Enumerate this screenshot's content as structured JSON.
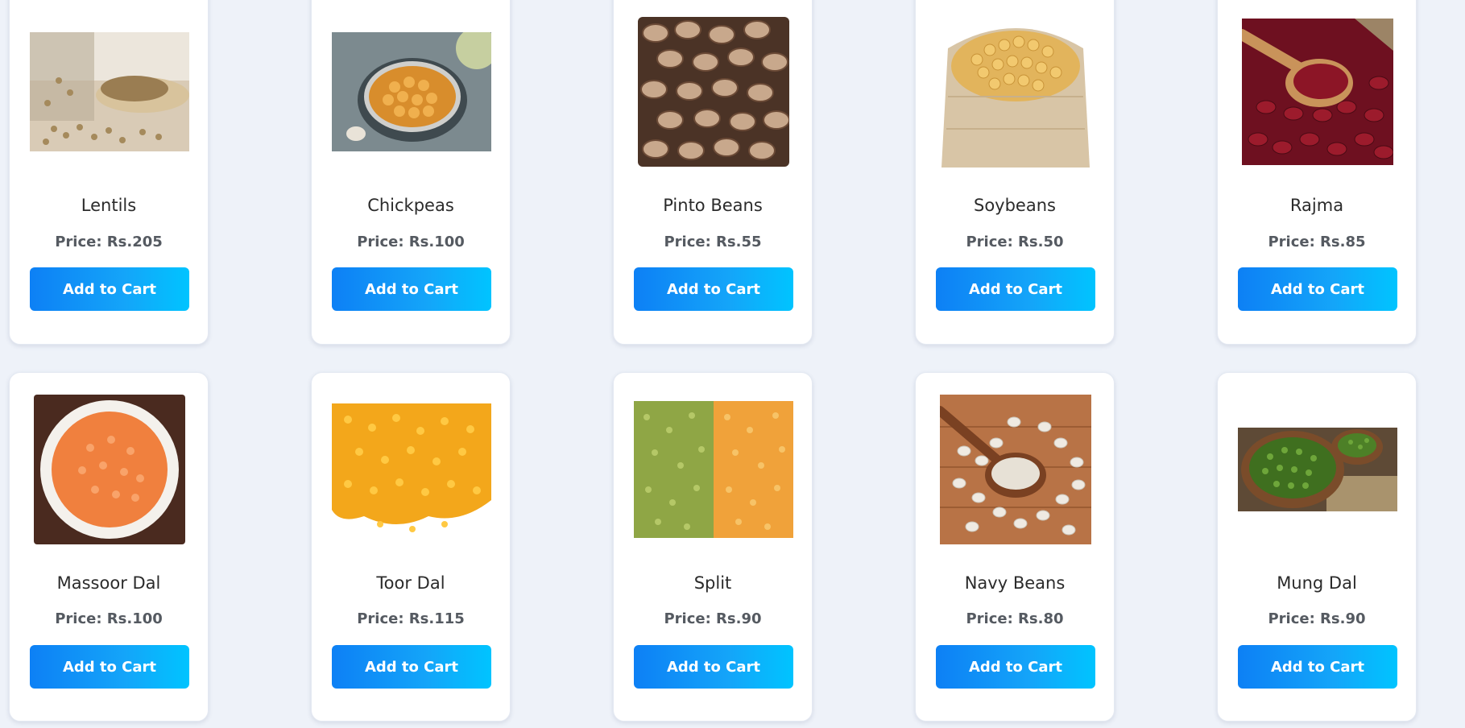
{
  "products": [
    {
      "name": "Lentils",
      "price": "Price: Rs.205",
      "button": "Add to Cart",
      "image_icon": "lentils-jar-icon"
    },
    {
      "name": "Chickpeas",
      "price": "Price: Rs.100",
      "button": "Add to Cart",
      "image_icon": "chickpeas-bowl-icon"
    },
    {
      "name": "Pinto Beans",
      "price": "Price: Rs.55",
      "button": "Add to Cart",
      "image_icon": "pinto-beans-icon"
    },
    {
      "name": "Soybeans",
      "price": "Price: Rs.50",
      "button": "Add to Cart",
      "image_icon": "soybeans-sack-icon"
    },
    {
      "name": "Rajma",
      "price": "Price: Rs.85",
      "button": "Add to Cart",
      "image_icon": "rajma-spoon-icon"
    },
    {
      "name": "Massoor Dal",
      "price": "Price: Rs.100",
      "button": "Add to Cart",
      "image_icon": "massoor-dal-bowl-icon"
    },
    {
      "name": "Toor Dal",
      "price": "Price: Rs.115",
      "button": "Add to Cart",
      "image_icon": "toor-dal-pile-icon"
    },
    {
      "name": "Split",
      "price": "Price: Rs.90",
      "button": "Add to Cart",
      "image_icon": "split-peas-icon"
    },
    {
      "name": "Navy Beans",
      "price": "Price: Rs.80",
      "button": "Add to Cart",
      "image_icon": "navy-beans-spoon-icon"
    },
    {
      "name": "Mung Dal",
      "price": "Price: Rs.90",
      "button": "Add to Cart",
      "image_icon": "mung-dal-bowl-icon"
    }
  ],
  "colors": {
    "page_background": "#eef2f9",
    "card_background": "#ffffff",
    "button_gradient_start": "#0d80f5",
    "button_gradient_end": "#00c4ff",
    "price_text": "#555a61"
  }
}
